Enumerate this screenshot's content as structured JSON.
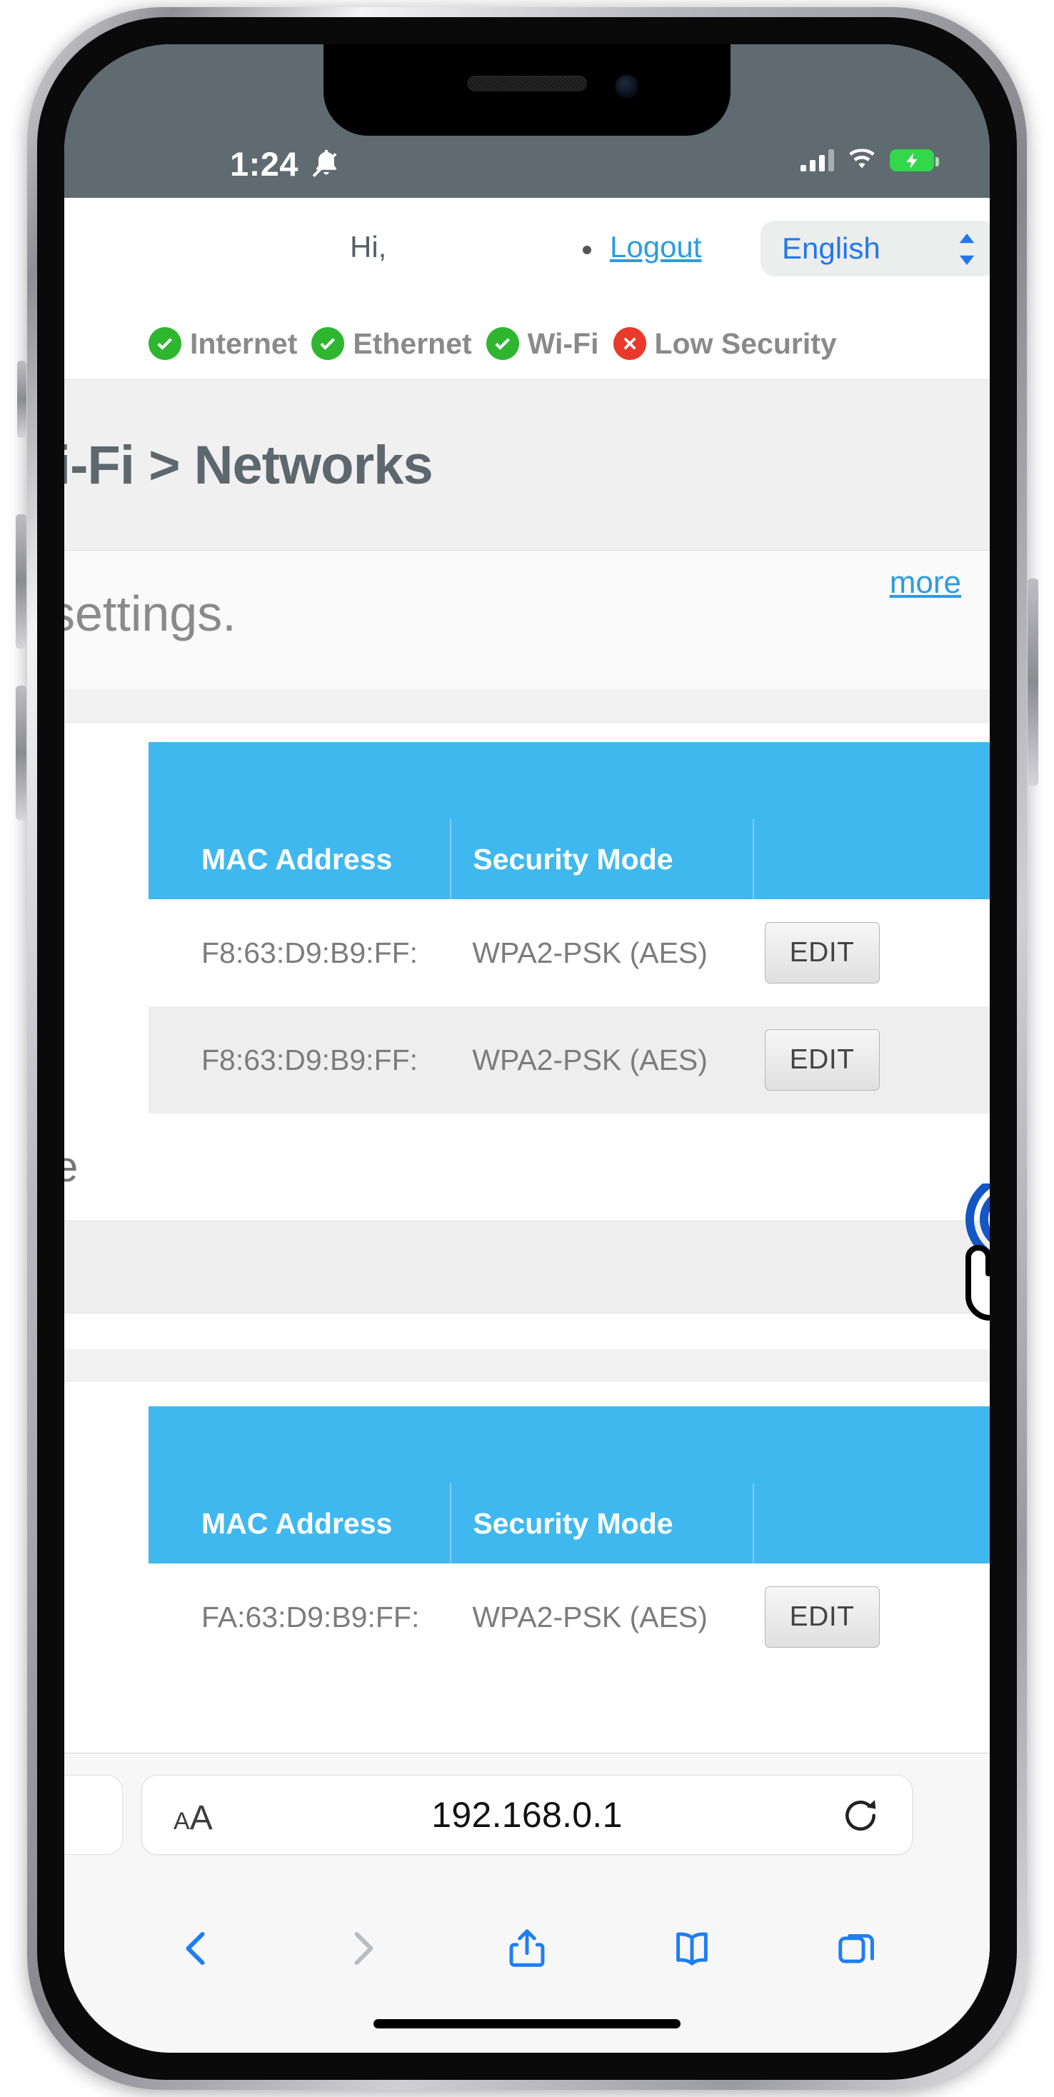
{
  "status_bar": {
    "time": "1:24",
    "bell_icon": "bell-muted-icon",
    "signal_icon": "cellular-signal-icon",
    "wifi_icon": "wifi-icon",
    "battery_icon": "battery-charging-icon"
  },
  "router_page": {
    "greeting": "Hi,",
    "separator": "•",
    "logout_label": "Logout",
    "language": {
      "selected": "English",
      "chevron_icon": "chevron-updown-icon"
    },
    "status_chips": [
      {
        "label": "Internet",
        "state": "ok",
        "icon": "check-circle-icon"
      },
      {
        "label": "Ethernet",
        "state": "ok",
        "icon": "check-circle-icon"
      },
      {
        "label": "Wi-Fi",
        "state": "ok",
        "icon": "check-circle-icon"
      },
      {
        "label": "Low Security",
        "state": "bad",
        "icon": "x-circle-icon"
      }
    ],
    "breadcrumb": "i-Fi > Networks",
    "description": "settings.",
    "more_label": "more",
    "tables": [
      {
        "headers": [
          "MAC Address",
          "Security Mode",
          ""
        ],
        "rows": [
          {
            "mac": "F8:63:D9:B9:FF:",
            "security": "WPA2-PSK (AES)",
            "action": "EDIT"
          },
          {
            "mac": "F8:63:D9:B9:FF:",
            "security": "WPA2-PSK (AES)",
            "action": "EDIT"
          }
        ]
      },
      {
        "headers": [
          "MAC Address",
          "Security Mode",
          ""
        ],
        "rows": [
          {
            "mac": "FA:63:D9:B9:FF:",
            "security": "WPA2-PSK (AES)",
            "action": "EDIT"
          }
        ]
      }
    ],
    "mid_stub": "e"
  },
  "browser": {
    "text_size_small": "A",
    "text_size_large": "A",
    "url": "192.168.0.1",
    "reload_icon": "reload-icon",
    "back_icon": "chevron-left-icon",
    "forward_icon": "chevron-right-icon",
    "share_icon": "share-icon",
    "bookmarks_icon": "book-icon",
    "tabs_icon": "tabs-icon"
  },
  "cursor": {
    "icon": "tap-hand-icon"
  },
  "colors": {
    "accent_blue": "#3fb8ef",
    "link_blue": "#2d9ce0",
    "ok_green": "#2fb62f",
    "error_red": "#e8392a",
    "statusbar_gray": "#5f6a71"
  }
}
